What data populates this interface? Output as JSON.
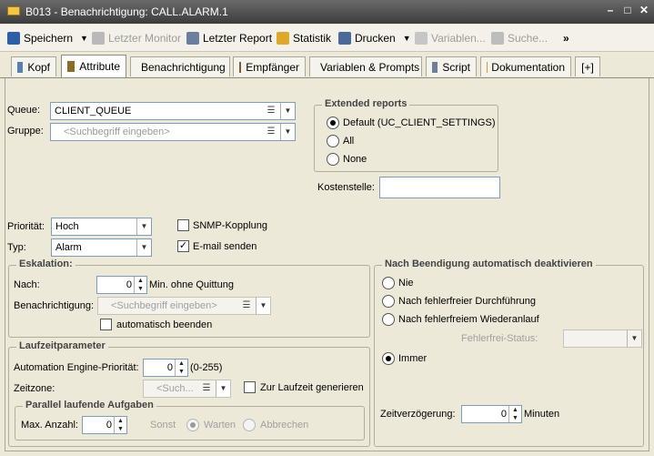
{
  "window": {
    "title": "B013 - Benachrichtigung: CALL.ALARM.1"
  },
  "toolbar": {
    "save": "Speichern",
    "last_monitor": "Letzter Monitor",
    "last_report": "Letzter Report",
    "statistics": "Statistik",
    "print": "Drucken",
    "variables": "Variablen...",
    "search": "Suche...",
    "more": "»"
  },
  "tabs": [
    "Kopf",
    "Attribute",
    "Benachrichtigung",
    "Empfänger",
    "Variablen & Prompts",
    "Script",
    "Dokumentation",
    "[+]"
  ],
  "form": {
    "queue_label": "Queue:",
    "queue_value": "CLIENT_QUEUE",
    "group_label": "Gruppe:",
    "group_placeholder": "<Suchbegriff eingeben>",
    "priority_label": "Priorität:",
    "priority_value": "Hoch",
    "type_label": "Typ:",
    "type_value": "Alarm",
    "snmp_label": "SNMP-Kopplung",
    "email_label": "E-mail senden"
  },
  "extended_reports": {
    "title": "Extended reports",
    "options": [
      "Default (UC_CLIENT_SETTINGS)",
      "All",
      "None"
    ],
    "cost_center_label": "Kostenstelle:",
    "cost_center_value": ""
  },
  "escalation": {
    "title": "Eskalation:",
    "after_label": "Nach:",
    "after_value": "0",
    "after_suffix": "Min. ohne Quittung",
    "notification_label": "Benachrichtigung:",
    "notification_placeholder": "<Suchbegriff eingeben>",
    "auto_end_label": "automatisch beenden"
  },
  "runtime": {
    "title": "Laufzeitparameter",
    "ae_priority_label": "Automation Engine-Priorität:",
    "ae_priority_value": "0",
    "ae_priority_range": "(0-255)",
    "timezone_label": "Zeitzone:",
    "timezone_placeholder": "<Such...",
    "gen_runtime_label": "Zur Laufzeit generieren"
  },
  "parallel": {
    "title": "Parallel laufende Aufgaben",
    "max_label": "Max. Anzahl:",
    "max_value": "0",
    "otherwise_label": "Sonst",
    "wait_label": "Warten",
    "abort_label": "Abbrechen"
  },
  "deactivate": {
    "title": "Nach Beendigung automatisch deaktivieren",
    "options": [
      "Nie",
      "Nach fehlerfreier Durchführung",
      "Nach fehlerfreiem Wiederanlauf",
      "Immer"
    ],
    "error_free_label": "Fehlerfrei-Status:",
    "delay_label": "Zeitverzögerung:",
    "delay_value": "0",
    "delay_suffix": "Minuten"
  }
}
